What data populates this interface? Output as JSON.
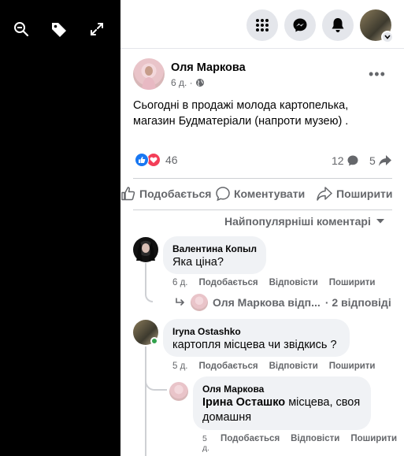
{
  "topbar": {
    "icons": [
      "menu-grid-icon",
      "messenger-icon",
      "bell-icon"
    ]
  },
  "viewer": {
    "icons": [
      "zoom-out-icon",
      "tag-icon",
      "fullscreen-icon"
    ]
  },
  "post": {
    "author": "Оля Маркова",
    "time": "6 д. ·",
    "text": "Сьогодні в продажі молода картопелька, магазин Будматеріали (напроти музею) .",
    "reaction_count": "46",
    "comment_count": "12",
    "share_count": "5",
    "actions": {
      "like": "Подобається",
      "comment": "Коментувати",
      "share": "Поширити"
    },
    "sort_label": "Найпопулярніші коментарі"
  },
  "comments": [
    {
      "name": "Валентина Копыл",
      "text": "Яка ціна?",
      "age": "6 д.",
      "like": "Подобається",
      "reply": "Відповісти",
      "share": "Поширити",
      "reply_summary_author": "Оля Маркова відп...",
      "reply_summary_count": "· 2 відповіді"
    },
    {
      "name": "Iryna Ostashko",
      "text": "картопля місцева чи звідкись ?",
      "age": "5 д.",
      "like": "Подобається",
      "reply": "Відповісти",
      "share": "Поширити"
    }
  ],
  "reply": {
    "name": "Оля Маркова",
    "mention": "Ірина Осташко",
    "text": " місцева, своя домашня",
    "age_line1": "5",
    "age_line2": "д.",
    "like": "Подобається",
    "reply": "Відповісти",
    "share": "Поширити"
  },
  "colors": {
    "accent": "#1877f2",
    "love": "#f33e58",
    "online": "#31a24c",
    "bubble": "#f0f2f5",
    "muted": "#65676b"
  }
}
